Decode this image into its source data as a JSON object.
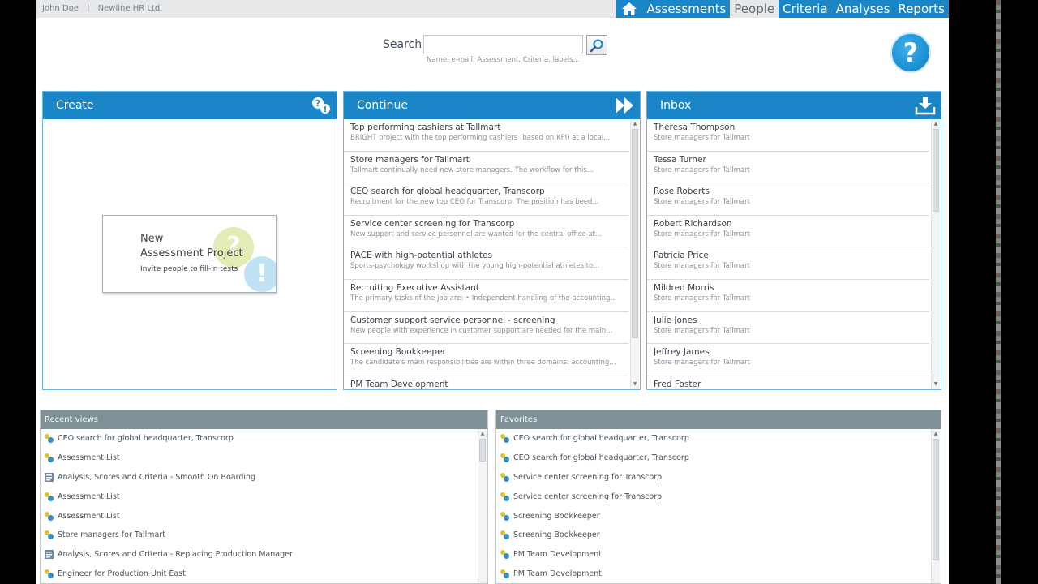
{
  "header": {
    "user_name": "John Doe",
    "separator": "|",
    "company": "Newline HR Ltd.",
    "nav": [
      {
        "label": "Assessments",
        "active": false
      },
      {
        "label": "People",
        "active": true
      },
      {
        "label": "Criteria",
        "active": false
      },
      {
        "label": "Analyses",
        "active": false
      },
      {
        "label": "Reports",
        "active": false
      }
    ],
    "home_icon": "home-icon"
  },
  "search": {
    "label": "Search",
    "value": "",
    "hint": "Name, e-mail, Assessment, Criteria, labels...",
    "icon": "magnifier-icon"
  },
  "help": {
    "glyph": "?"
  },
  "create": {
    "title": "Create",
    "card": {
      "line1": "New",
      "line2": "Assessment Project",
      "line3": "Invite people to fill-in tests",
      "q_glyph": "?",
      "e_glyph": "!"
    }
  },
  "continue": {
    "title": "Continue",
    "items": [
      {
        "title": "Top performing cashiers at Tallmart",
        "desc": "BRIGHT project with the top performing cashiers (based on KPI) at a local..."
      },
      {
        "title": "Store managers for Tallmart",
        "desc": "Tallmart continually need new store managers. The workflow for this..."
      },
      {
        "title": "CEO search for global headquarter, Transcorp",
        "desc": "Recruitment for the new top CEO for Transcorp. The position has beed..."
      },
      {
        "title": "Service center screening for Transcorp",
        "desc": "New support and service personnel are wanted for the central office at..."
      },
      {
        "title": "PACE with high-potential athletes",
        "desc": "Sports-psychology workshop with the young high-potential athletes to..."
      },
      {
        "title": "Recruiting Executive Assistant",
        "desc": "The primary tasks of the job are: • Independent handling of the accounting..."
      },
      {
        "title": "Customer support service personnel - screening",
        "desc": "New people with experience in customer support are needed for the main..."
      },
      {
        "title": "Screening Bookkeeper",
        "desc": "The candidate's main responsibilities are within three domains: accounting..."
      },
      {
        "title": "PM Team Development",
        "desc": ""
      }
    ]
  },
  "inbox": {
    "title": "Inbox",
    "items": [
      {
        "title": "Theresa Thompson",
        "desc": "Store managers for Tallmart"
      },
      {
        "title": "Tessa Turner",
        "desc": "Store managers for Tallmart"
      },
      {
        "title": "Rose Roberts",
        "desc": "Store managers for Tallmart"
      },
      {
        "title": "Robert Richardson",
        "desc": "Store managers for Tallmart"
      },
      {
        "title": "Patricia Price",
        "desc": "Store managers for Tallmart"
      },
      {
        "title": "Mildred Morris",
        "desc": "Store managers for Tallmart"
      },
      {
        "title": "Julie Jones",
        "desc": "Store managers for Tallmart"
      },
      {
        "title": "Jeffrey James",
        "desc": "Store managers for Tallmart"
      },
      {
        "title": "Fred Foster",
        "desc": ""
      }
    ]
  },
  "recent": {
    "title": "Recent views",
    "items": [
      {
        "label": "CEO search for global headquarter, Transcorp",
        "icon": "people-icon"
      },
      {
        "label": "Assessment List",
        "icon": "people-icon"
      },
      {
        "label": "Analysis, Scores and Criteria - Smooth On Boarding",
        "icon": "report-icon"
      },
      {
        "label": "Assessment List",
        "icon": "people-icon"
      },
      {
        "label": "Assessment List",
        "icon": "people-icon"
      },
      {
        "label": "Store managers for Tallmart",
        "icon": "people-icon"
      },
      {
        "label": "Analysis, Scores and Criteria - Replacing Production Manager",
        "icon": "report-icon"
      },
      {
        "label": "Engineer for Production Unit East",
        "icon": "people-icon"
      }
    ]
  },
  "favorites": {
    "title": "Favorites",
    "items": [
      {
        "label": "CEO search for global headquarter, Transcorp",
        "icon": "people-icon"
      },
      {
        "label": "CEO search for global headquarter, Transcorp",
        "icon": "people-icon"
      },
      {
        "label": "Service center screening for Transcorp",
        "icon": "people-icon"
      },
      {
        "label": "Service center screening for Transcorp",
        "icon": "people-icon"
      },
      {
        "label": "Screening Bookkeeper",
        "icon": "people-icon"
      },
      {
        "label": "Screening Bookkeeper",
        "icon": "people-icon"
      },
      {
        "label": "PM Team Development",
        "icon": "people-icon"
      },
      {
        "label": "PM Team Development",
        "icon": "people-icon"
      }
    ]
  },
  "colors": {
    "accent": "#1a86c8",
    "subheader": "#7f9196"
  }
}
